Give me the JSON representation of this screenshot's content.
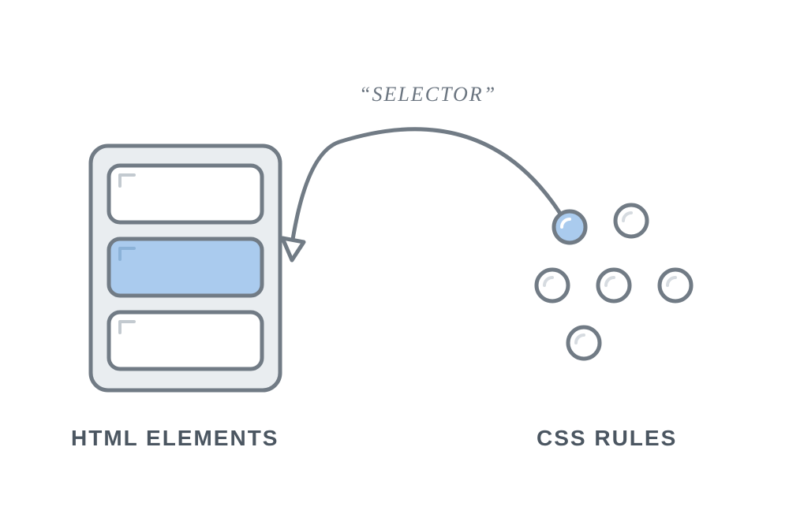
{
  "diagram": {
    "selector_label": "SELECTOR",
    "html_elements_label": "HTML ELEMENTS",
    "css_rules_label": "CSS RULES",
    "colors": {
      "outline": "#717b85",
      "muted_fill": "#e9edf0",
      "highlight_fill": "#aacbee",
      "white": "#ffffff"
    },
    "html_box": {
      "rows": 3,
      "highlighted_row_index": 1
    },
    "css_rules": {
      "circles": 6,
      "highlighted_circle_index": 0
    }
  }
}
